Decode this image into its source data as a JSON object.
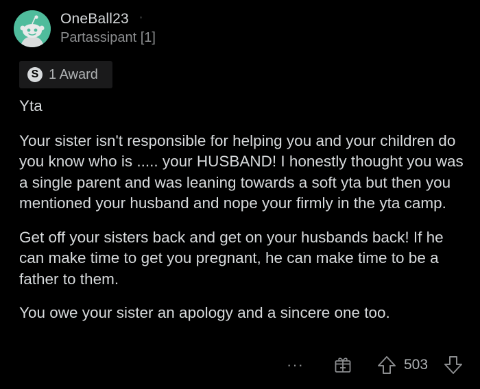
{
  "comment": {
    "username": "OneBall23",
    "flair": "Partassipant [1]",
    "award": {
      "icon": "silver-award-icon",
      "icon_glyph": "S",
      "label": "1 Award"
    },
    "paragraphs": [
      "Yta",
      "Your sister isn't responsible for helping you and your children do you know who is ..... your HUSBAND!  I honestly thought you was a single parent and was leaning towards a soft yta but then you mentioned your husband and nope your firmly in the yta camp.",
      "Get off your sisters back and get on your husbands back! If he can make time to get you pregnant, he can make time to be a father to them.",
      "You owe your sister an apology and a sincere one too."
    ],
    "actions": {
      "more_label": "···",
      "gift_icon": "gift-icon",
      "upvote_icon": "upvote-arrow-icon",
      "score": "503",
      "downvote_icon": "downvote-arrow-icon"
    }
  },
  "colors": {
    "background": "#000000",
    "text": "#d7dadc",
    "muted": "#8c8e90",
    "avatar": "#4fbc9c",
    "award_bg": "#1a1a1b"
  }
}
